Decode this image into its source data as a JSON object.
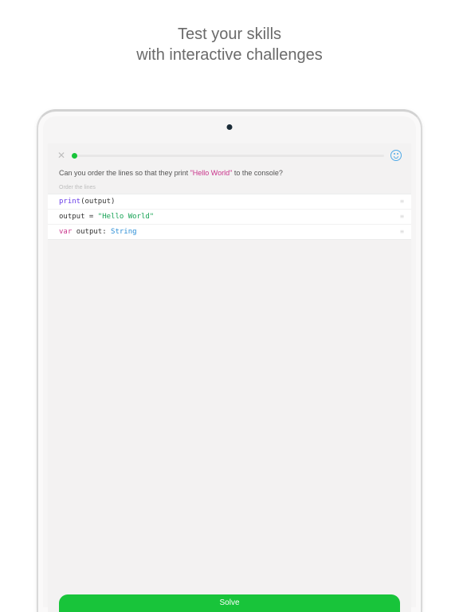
{
  "promo": {
    "line1": "Test your skills",
    "line2": "with interactive challenges"
  },
  "challenge": {
    "question_prefix": "Can you order the lines so that they print ",
    "question_highlight": "\"Hello World\"",
    "question_suffix": " to the console?",
    "hint": "Order the lines",
    "lines": [
      {
        "tokens": [
          {
            "t": "print",
            "c": "tok-fn"
          },
          {
            "t": "(output)",
            "c": ""
          }
        ]
      },
      {
        "tokens": [
          {
            "t": "output = ",
            "c": ""
          },
          {
            "t": "\"Hello World\"",
            "c": "tok-str"
          }
        ]
      },
      {
        "tokens": [
          {
            "t": "var ",
            "c": "tok-kw"
          },
          {
            "t": "output: ",
            "c": ""
          },
          {
            "t": "String",
            "c": "tok-type"
          }
        ]
      }
    ]
  },
  "buttons": {
    "solve": "Solve"
  }
}
